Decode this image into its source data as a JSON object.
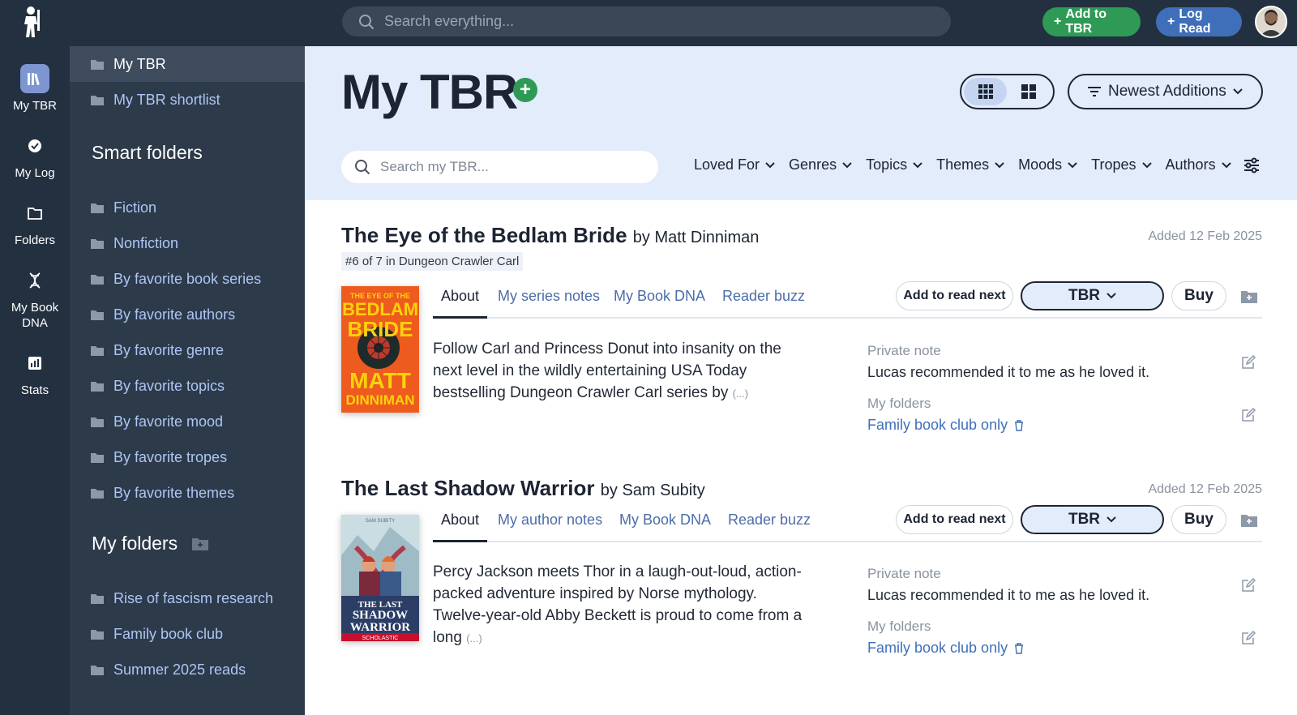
{
  "topbar": {
    "search_placeholder": "Search everything...",
    "add_tbr_label": "Add to TBR",
    "log_read_label": "Log Read"
  },
  "rail": {
    "items": [
      {
        "label": "My TBR",
        "icon": "library-icon",
        "active": true
      },
      {
        "label": "My Log",
        "icon": "check-circle-icon"
      },
      {
        "label": "Folders",
        "icon": "folder-icon"
      },
      {
        "label": "My Book DNA",
        "icon": "dna-icon"
      },
      {
        "label": "Stats",
        "icon": "stats-icon"
      }
    ]
  },
  "folders": {
    "top": [
      "My TBR",
      "My TBR shortlist"
    ],
    "smart_heading": "Smart folders",
    "smart": [
      "Fiction",
      "Nonfiction",
      "By favorite book series",
      "By favorite authors",
      "By favorite genre",
      "By favorite topics",
      "By favorite mood",
      "By favorite tropes",
      "By favorite themes"
    ],
    "my_heading": "My folders",
    "mine": [
      "Rise of fascism research",
      "Family book club",
      "Summer 2025 reads"
    ]
  },
  "header": {
    "title": "My TBR",
    "sort_label": "Newest Additions"
  },
  "filterbar": {
    "search_placeholder": "Search my TBR...",
    "filters": [
      "Loved For",
      "Genres",
      "Topics",
      "Themes",
      "Moods",
      "Tropes",
      "Authors"
    ]
  },
  "books": [
    {
      "title": "The Eye of the Bedlam Bride",
      "by": "by Matt Dinniman",
      "added": "Added 12 Feb 2025",
      "series": "#6 of 7 in Dungeon Crawler Carl",
      "tabs": [
        "About",
        "My series notes",
        "My Book DNA",
        "Reader buzz"
      ],
      "read_next_label": "Add to read next",
      "status": "TBR",
      "buy_label": "Buy",
      "description": "Follow Carl and Princess Donut into insanity on the next level in the wildly entertaining USA Today bestselling Dungeon Crawler Carl series by",
      "more": "(...)",
      "note_label": "Private note",
      "note": "Lucas recommended it to me as he loved it.",
      "folders_label": "My folders",
      "folder": "Family book club only",
      "cover": {
        "line1": "THE EYE OF THE",
        "line2": "BEDLAM",
        "line3": "BRIDE",
        "author1": "MATT",
        "author2": "DINNIMAN"
      }
    },
    {
      "title": "The Last Shadow Warrior",
      "by": "by Sam Subity",
      "added": "Added 12 Feb 2025",
      "tabs": [
        "About",
        "My author notes",
        "My Book DNA",
        "Reader buzz"
      ],
      "read_next_label": "Add to read next",
      "status": "TBR",
      "buy_label": "Buy",
      "description": "Percy Jackson meets Thor in a laugh-out-loud, action-packed adventure inspired by Norse mythology. Twelve-year-old Abby Beckett is proud to come from a long",
      "more": "(...)",
      "note_label": "Private note",
      "note": "Lucas recommended it to me as he loved it.",
      "folders_label": "My folders",
      "folder": "Family book club only",
      "cover": {
        "author": "SAM SUBITY",
        "line1": "THE LAST",
        "line2": "SHADOW",
        "line3": "WARRIOR",
        "publisher": "SCHOLASTIC"
      }
    }
  ],
  "colors": {
    "dark": "#233040",
    "panel": "#2d3a4a",
    "accent_green": "#2e9a55",
    "accent_blue": "#3f6fb8",
    "header_bg": "#e3ecfb"
  }
}
